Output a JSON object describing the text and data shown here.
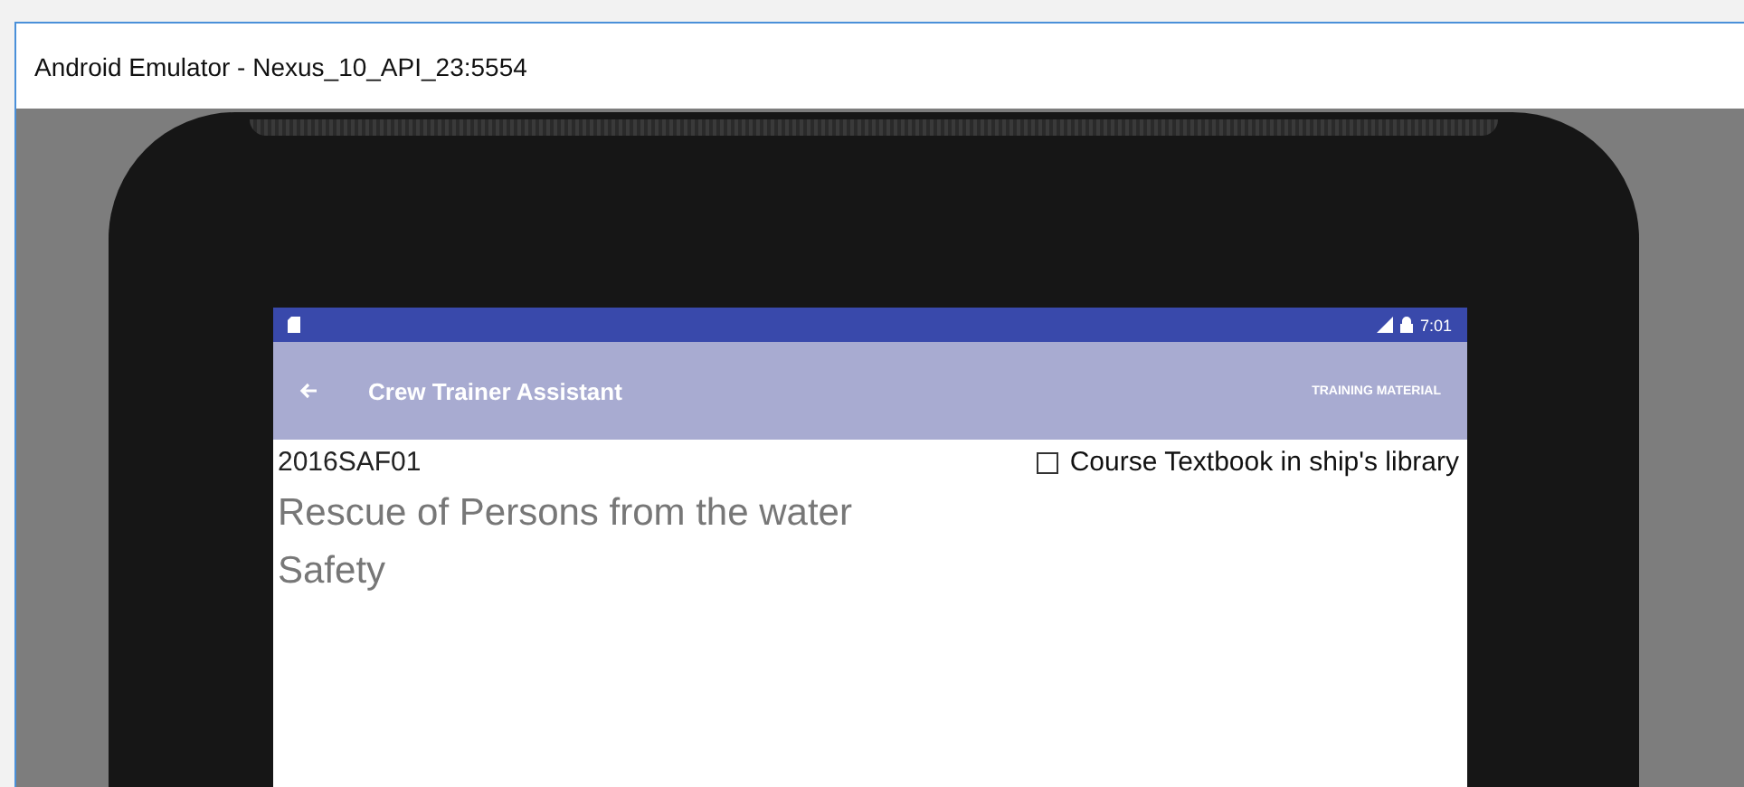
{
  "window": {
    "title": "Android Emulator - Nexus_10_API_23:5554"
  },
  "status_bar": {
    "time": "7:01"
  },
  "app_bar": {
    "title": "Crew Trainer Assistant",
    "action": "TRAINING MATERIAL"
  },
  "course": {
    "code": "2016SAF01",
    "textbook": {
      "label": "Course Textbook in ship's library",
      "checked": false
    },
    "title": "Rescue of Persons from the water",
    "category": "Safety"
  }
}
